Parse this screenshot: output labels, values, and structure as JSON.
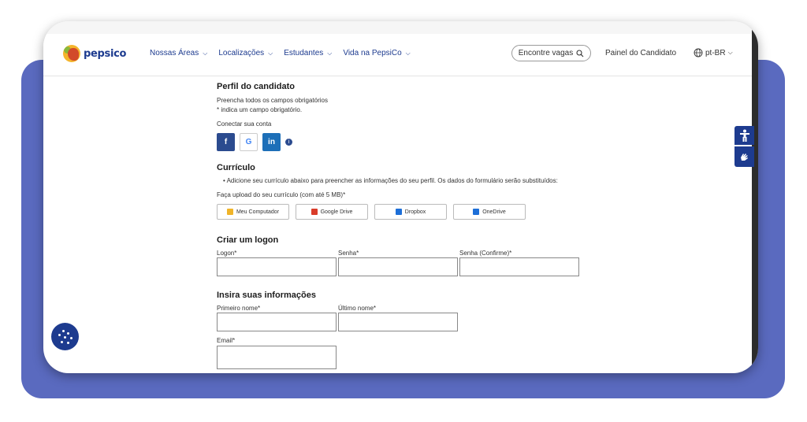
{
  "nav": {
    "logo": "pepsico",
    "links": [
      {
        "label": "Nossas Áreas",
        "dropdown": true
      },
      {
        "label": "Localizações",
        "dropdown": true
      },
      {
        "label": "Estudantes",
        "dropdown": true
      },
      {
        "label": "Vida na PepsiCo",
        "dropdown": true
      }
    ],
    "search_label": "Encontre vagas",
    "candidate_panel": "Painel do Candidato",
    "language": "pt-BR"
  },
  "profile": {
    "title": "Perfil do candidato",
    "required_note": "Preencha todos os campos obrigatórios",
    "asterisk_note": "* indica um campo obrigatório.",
    "connect_label": "Conectar sua conta"
  },
  "resume": {
    "title": "Currículo",
    "bullet": "Adicione seu currículo abaixo para preencher as informações do seu perfil. Os dados do formulário serão substituídos:",
    "upload_label": "Faça upload do seu currículo (com até 5 MB)*",
    "sources": [
      {
        "label": "Meu Computador",
        "icon": "folder-icon",
        "color": "#f0b429"
      },
      {
        "label": "Google Drive",
        "icon": "google-drive-icon",
        "color": "#d93c2a"
      },
      {
        "label": "Dropbox",
        "icon": "dropbox-icon",
        "color": "#1d6fd8"
      },
      {
        "label": "OneDrive",
        "icon": "onedrive-icon",
        "color": "#1d6fd8"
      }
    ]
  },
  "logon": {
    "title": "Criar um logon",
    "logon_label": "Logon*",
    "password_label": "Senha*",
    "confirm_label": "Senha (Confirme)*"
  },
  "info": {
    "title": "Insira suas informações",
    "first_name_label": "Primeiro nome*",
    "last_name_label": "Último nome*",
    "email_label": "Email*"
  },
  "colors": {
    "brand_blue": "#1d3b8f",
    "backdrop": "#5a6abf"
  }
}
